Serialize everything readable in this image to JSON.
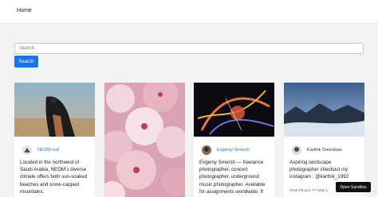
{
  "nav": {
    "home_label": "Home"
  },
  "search": {
    "placeholder": "Search",
    "value": "",
    "button_label": "Search"
  },
  "cards": [
    {
      "author": "NEOM null",
      "bio": "Located in the northwest of Saudi Arabia, NEOM’s diverse climate offers both sun-soaked beaches and snow-capped mountains.",
      "stats": ""
    },
    {
      "author": "",
      "bio": "",
      "stats": ""
    },
    {
      "author": "Evgeniy Smersh",
      "bio": "Evgeniy Smersh — freelance photographer, concert photographer, underground music photographer. Available for assignments worldwide. If",
      "stats": ""
    },
    {
      "author": "Karthik Sreenivas",
      "bio": "Aspiring landscape photographer checkout my instagram : @karthik_1992",
      "stats": "Total Photos ?? Total L"
    }
  ],
  "sandbox": {
    "label": "Open Sandbox"
  },
  "colors": {
    "accent": "#1a73e8",
    "background": "#f2f2f2"
  }
}
